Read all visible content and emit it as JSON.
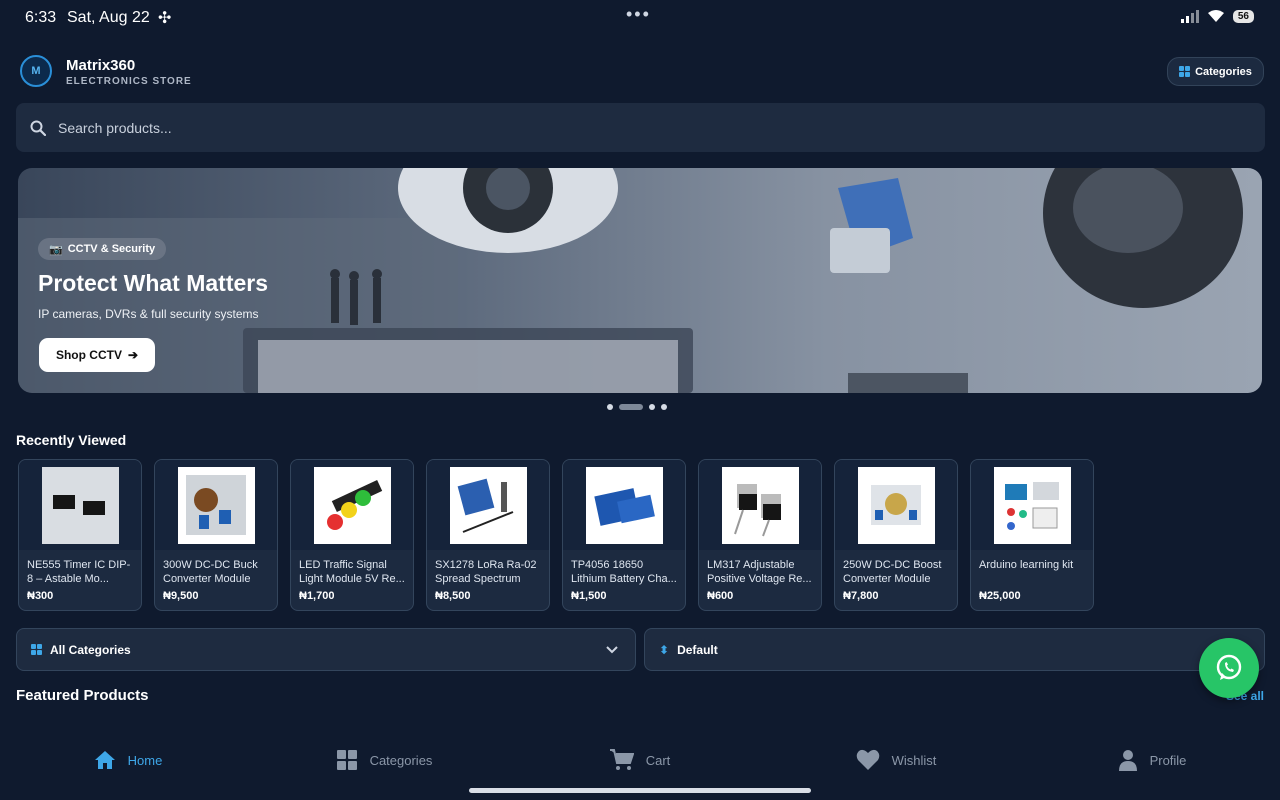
{
  "status_bar": {
    "time": "6:33",
    "date": "Sat, Aug 22",
    "battery": "56"
  },
  "header": {
    "logo_text": "M",
    "brand": "Matrix360",
    "subtitle": "ELECTRONICS STORE",
    "categories_button": "Categories"
  },
  "search": {
    "placeholder": "Search products..."
  },
  "banner": {
    "tag": "CCTV & Security",
    "title": "Protect What Matters",
    "subtitle": "IP cameras, DVRs & full security systems",
    "button": "Shop CCTV",
    "slide_count": 4,
    "active_slide": 2
  },
  "recently_viewed": {
    "title": "Recently Viewed",
    "items": [
      {
        "name": "NE555 Timer IC DIP-8 – Astable Mo...",
        "price": "₦300"
      },
      {
        "name": "300W DC-DC Buck Converter Module C...",
        "price": "₦9,500"
      },
      {
        "name": "LED Traffic Signal Light Module 5V Re...",
        "price": "₦1,700"
      },
      {
        "name": "SX1278 LoRa Ra-02 Spread Spectrum W...",
        "price": "₦8,500"
      },
      {
        "name": "TP4056 18650 Lithium Battery Cha...",
        "price": "₦1,500"
      },
      {
        "name": "LM317 Adjustable Positive Voltage Re...",
        "price": "₦600"
      },
      {
        "name": "250W DC-DC Boost Converter Module C...",
        "price": "₦7,800"
      },
      {
        "name": "Arduino learning kit",
        "price": "₦25,000"
      }
    ]
  },
  "filters": {
    "category": "All Categories",
    "sort": "Default"
  },
  "featured": {
    "title": "Featured Products",
    "see_all": "See all"
  },
  "nav": {
    "home": "Home",
    "categories": "Categories",
    "cart": "Cart",
    "wishlist": "Wishlist",
    "profile": "Profile"
  },
  "colors": {
    "accent": "#3ea7e8",
    "background": "#0f1a2e",
    "card": "#1c2a40",
    "whatsapp": "#27c567"
  }
}
